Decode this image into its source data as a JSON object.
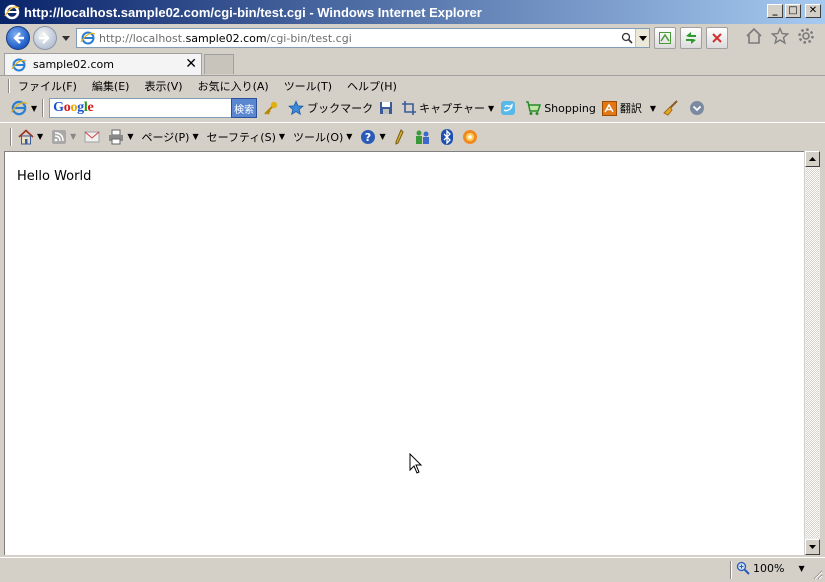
{
  "window": {
    "title": "http://localhost.sample02.com/cgi-bin/test.cgi - Windows Internet Explorer",
    "minimize": "_",
    "maximize": "□",
    "close": "✕"
  },
  "address_bar": {
    "url_scheme": "http://localhost.",
    "url_host": "sample02.com",
    "url_path": "/cgi-bin/test.cgi"
  },
  "tab": {
    "title": "sample02.com",
    "close": "✕"
  },
  "menu": [
    "ファイル(F)",
    "編集(E)",
    "表示(V)",
    "お気に入り(A)",
    "ツール(T)",
    "ヘルプ(H)"
  ],
  "google_toolbar": {
    "search_button": "検索",
    "bookmark": "ブックマーク",
    "capture": "キャプチャー",
    "shopping": "Shopping",
    "translate": "翻訳"
  },
  "command_bar": {
    "page": "ページ(P)",
    "safety": "セーフティ(S)",
    "tools": "ツール(O)"
  },
  "content": {
    "text": "Hello World"
  },
  "status_bar": {
    "zoom": "100%"
  },
  "colors": {
    "titlebar_start": "#0a246a",
    "titlebar_end": "#a6caf0",
    "chrome": "#d4d0c8"
  }
}
